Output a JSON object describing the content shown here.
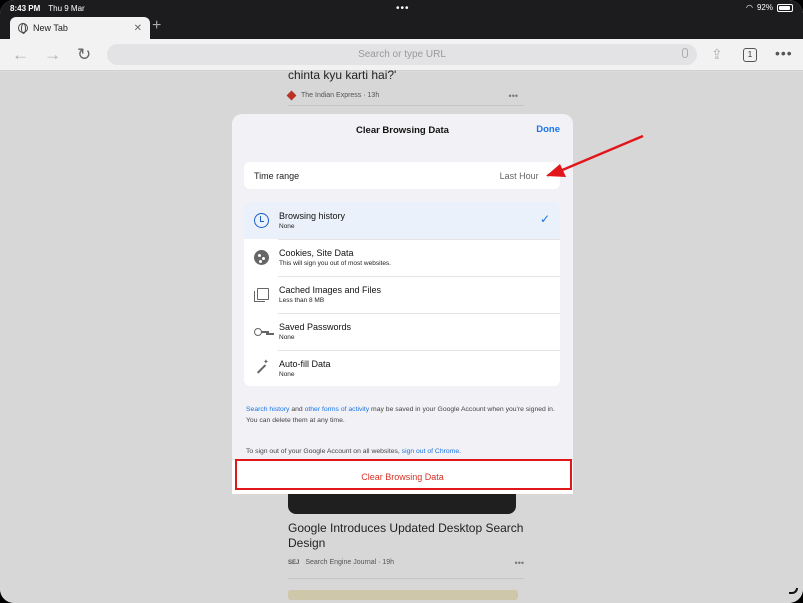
{
  "status_bar": {
    "time": "8:43 PM",
    "date": "Thu 9 Mar",
    "battery": "92%"
  },
  "tab": {
    "title": "New Tab"
  },
  "toolbar": {
    "omnibox_placeholder": "Search or type URL",
    "tab_count": "1"
  },
  "background": {
    "top_article": {
      "headline": "chinta kyu karti hai?'",
      "source": "The Indian Express · 13h"
    },
    "bottom_article": {
      "headline": "Google Introduces Updated Desktop Search Design",
      "source_logo": "SEJ",
      "source": "Search Engine Journal · 19h"
    }
  },
  "dialog": {
    "title": "Clear Browsing Data",
    "done_label": "Done",
    "time_range": {
      "label": "Time range",
      "value": "Last Hour"
    },
    "items": [
      {
        "label": "Browsing history",
        "sub": "None",
        "icon": "history-icon",
        "selected": true
      },
      {
        "label": "Cookies, Site Data",
        "sub": "This will sign you out of most websites.",
        "icon": "cookie-icon",
        "selected": false
      },
      {
        "label": "Cached Images and Files",
        "sub": "Less than 8 MB",
        "icon": "cache-icon",
        "selected": false
      },
      {
        "label": "Saved Passwords",
        "sub": "None",
        "icon": "key-icon",
        "selected": false
      },
      {
        "label": "Auto-fill Data",
        "sub": "None",
        "icon": "wand-icon",
        "selected": false
      }
    ],
    "note1": {
      "link1": "Search history",
      "and": " and ",
      "link2": "other forms of activity",
      "rest": " may be saved in your Google Account when you're signed in. You can delete them at any time."
    },
    "note2": {
      "text": "To sign out of your Google Account on all websites, ",
      "link": "sign out of Chrome",
      "end": "."
    },
    "clear_button": "Clear Browsing Data"
  },
  "colors": {
    "accent": "#1a73e8",
    "destructive": "#d93025",
    "annotation": "#e0161b"
  }
}
